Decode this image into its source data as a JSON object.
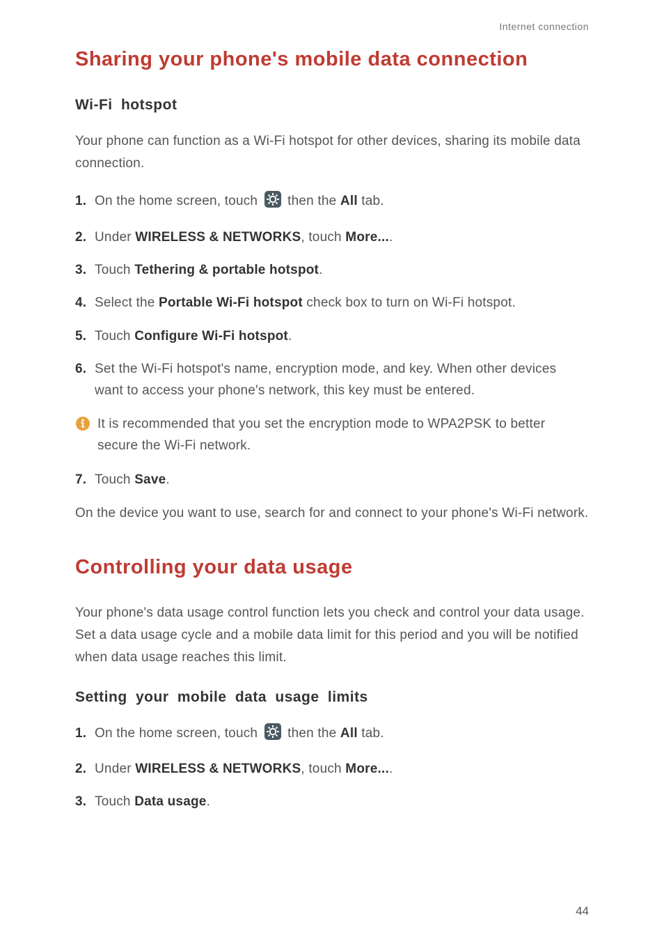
{
  "header": {
    "label": "Internet connection"
  },
  "section1": {
    "title": "Sharing your phone's mobile data connection",
    "sub1": "Wi-Fi  hotspot",
    "intro": "Your phone can function as a Wi-Fi hotspot for other devices, sharing its mobile data connection.",
    "steps": {
      "s1a": "On the home screen, touch",
      "s1b": "then the",
      "s1c": "All",
      "s1d": " tab.",
      "s2a": "Under ",
      "s2b": "WIRELESS & NETWORKS",
      "s2c": ", touch ",
      "s2d": "More...",
      "s2e": ".",
      "s3a": "Touch ",
      "s3b": "Tethering & portable hotspot",
      "s3c": ".",
      "s4a": "Select the ",
      "s4b": "Portable Wi-Fi hotspot",
      "s4c": " check box to turn on Wi-Fi hotspot.",
      "s5a": "Touch ",
      "s5b": "Configure Wi-Fi hotspot",
      "s5c": ".",
      "s6": "Set the Wi-Fi hotspot's name, encryption mode, and key. When other devices want to access your phone's network, this key must be entered.",
      "note": "It is recommended that you set the encryption mode to WPA2PSK to better secure the Wi-Fi network.",
      "s7a": "Touch ",
      "s7b": "Save",
      "s7c": "."
    },
    "outro": "On the device you want to use, search for and connect to your phone's Wi-Fi network."
  },
  "section2": {
    "title": "Controlling your data usage",
    "intro": "Your phone's data usage control function lets you check and control your data usage. Set a data usage cycle and a mobile data limit for this period and you will be notified when data usage reaches this limit.",
    "sub1": "Setting  your  mobile  data  usage  limits",
    "steps": {
      "s1a": "On the home screen, touch",
      "s1b": "then the",
      "s1c": "All",
      "s1d": " tab.",
      "s2a": "Under ",
      "s2b": "WIRELESS & NETWORKS",
      "s2c": ", touch ",
      "s2d": "More...",
      "s2e": ".",
      "s3a": "Touch ",
      "s3b": "Data usage",
      "s3c": "."
    }
  },
  "pageNumber": "44",
  "nums": {
    "n1": "1.",
    "n2": "2.",
    "n3": "3.",
    "n4": "4.",
    "n5": "5.",
    "n6": "6.",
    "n7": "7."
  }
}
